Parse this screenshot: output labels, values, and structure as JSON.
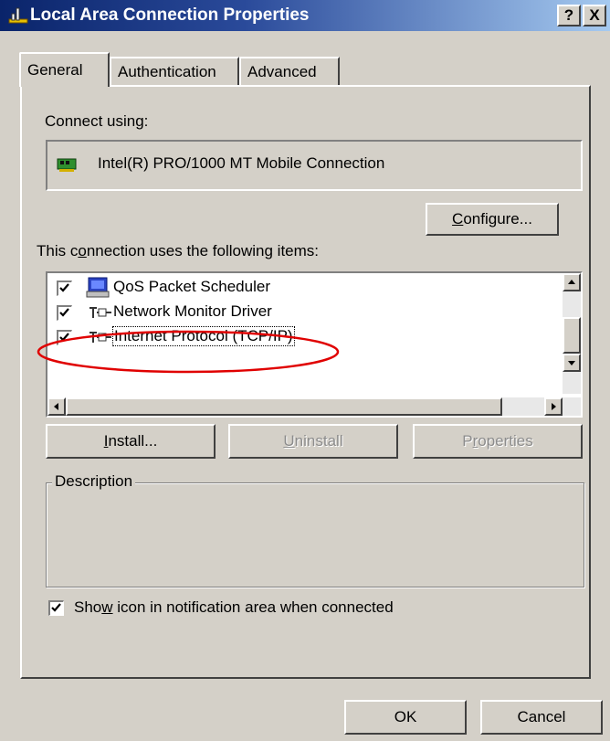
{
  "window": {
    "title": "Local Area Connection Properties",
    "help_btn": "?",
    "close_btn": "X"
  },
  "tabs": [
    {
      "label": "General",
      "selected": true
    },
    {
      "label": "Authentication",
      "selected": false
    },
    {
      "label": "Advanced",
      "selected": false
    }
  ],
  "connect_using": {
    "label": "Connect using:",
    "adapter": "Intel(R) PRO/1000 MT Mobile Connection",
    "adapter_icon": "network-card-icon"
  },
  "configure_button": {
    "label_pre": "",
    "label_ul": "C",
    "label_post": "onfigure..."
  },
  "items_section": {
    "label_pre": "This c",
    "label_ul": "o",
    "label_post": "nnection uses the following items:",
    "items": [
      {
        "label": "QoS Packet Scheduler",
        "checked": true,
        "icon": "scheduler-icon"
      },
      {
        "label": "Network Monitor Driver",
        "checked": true,
        "icon": "protocol-icon"
      },
      {
        "label": "Internet Protocol (TCP/IP)",
        "checked": true,
        "icon": "protocol-icon",
        "highlighted": true
      }
    ]
  },
  "buttons": {
    "install": {
      "ul": "I",
      "rest": "nstall..."
    },
    "uninstall": {
      "ul": "U",
      "rest": "ninstall"
    },
    "properties": {
      "pre": "P",
      "ul": "r",
      "rest": "operties"
    }
  },
  "description": {
    "label": "Description"
  },
  "notification": {
    "pre": "Sho",
    "ul": "w",
    "post": " icon in notification area when connected",
    "checked": true
  },
  "footer": {
    "ok": "OK",
    "cancel": "Cancel"
  },
  "colors": {
    "title_start": "#0a246a",
    "title_end": "#a6caf0",
    "face": "#d4d0c8",
    "highlight_ellipse": "#e00000"
  }
}
